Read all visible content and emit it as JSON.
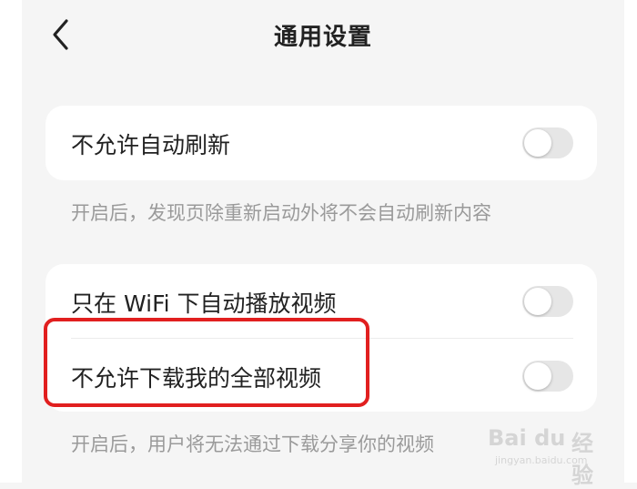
{
  "header": {
    "back_icon": "chevron-left-icon",
    "title": "通用设置"
  },
  "settings": {
    "group1": {
      "items": [
        {
          "label": "不允许自动刷新",
          "enabled": false
        }
      ],
      "hint": "开启后，发现页除重新启动外将不会自动刷新内容"
    },
    "group2": {
      "items": [
        {
          "label": "只在 WiFi 下自动播放视频",
          "enabled": false
        },
        {
          "label": "不允许下载我的全部视频",
          "enabled": false
        }
      ],
      "hint": "开启后，用户将无法通过下载分享你的视频"
    }
  },
  "annotation": {
    "highlight_color": "#e11f1f"
  },
  "watermark": {
    "brand": "Bai du",
    "suffix": "经验",
    "url": "jingyan.baidu.com"
  },
  "colors": {
    "background": "#f5f5f5",
    "card": "#ffffff",
    "toggle_off": "#e6e6e6"
  }
}
